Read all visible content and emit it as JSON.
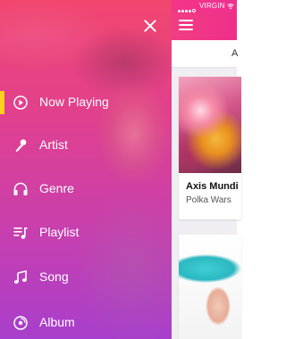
{
  "status_bar": {
    "carrier": "VIRGIN"
  },
  "tabs": {
    "active_tab_partial": "A"
  },
  "cards": [
    {
      "title": "Axis Mundi",
      "subtitle": "Polka Wars"
    },
    {
      "title": "",
      "subtitle": ""
    }
  ],
  "drawer": {
    "items": [
      {
        "label": "Now Playing",
        "icon": "play-circle-icon",
        "active": true
      },
      {
        "label": "Artist",
        "icon": "microphone-icon",
        "active": false
      },
      {
        "label": "Genre",
        "icon": "headphones-icon",
        "active": false
      },
      {
        "label": "Playlist",
        "icon": "playlist-icon",
        "active": false
      },
      {
        "label": "Song",
        "icon": "music-note-icon",
        "active": false
      },
      {
        "label": "Album",
        "icon": "disc-icon",
        "active": false
      }
    ]
  },
  "colors": {
    "accent": "#ffd21f",
    "drawer_top": "#f2466f",
    "drawer_bottom": "#a83fcc",
    "appbar": "#f0338a"
  }
}
